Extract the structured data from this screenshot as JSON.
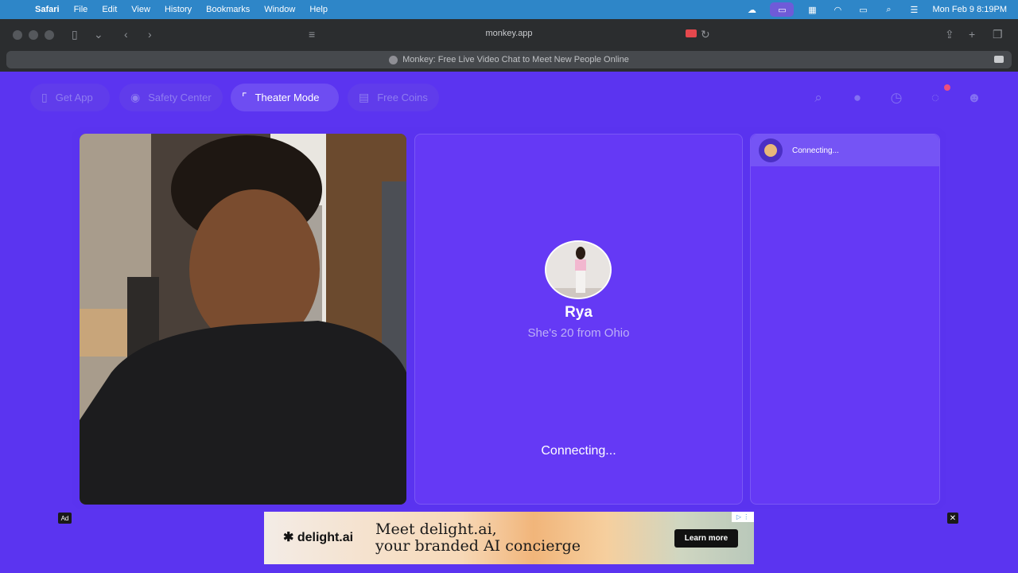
{
  "menubar": {
    "app_name": "Safari",
    "menus": [
      "File",
      "Edit",
      "View",
      "History",
      "Bookmarks",
      "Window",
      "Help"
    ],
    "datetime": "Mon Feb 9  8:19PM"
  },
  "browser": {
    "url": "monkey.app",
    "tab_title": "Monkey: Free Live Video Chat to Meet New People Online"
  },
  "header": {
    "nav": [
      {
        "label": "Get App",
        "icon": "phone-icon"
      },
      {
        "label": "Safety Center",
        "icon": "shield-icon"
      },
      {
        "label": "Theater Mode",
        "icon": "expand-icon"
      },
      {
        "label": "Free Coins",
        "icon": "coins-icon"
      }
    ],
    "icons": [
      "search-icon",
      "avatar-icon",
      "history-icon",
      "chat-icon",
      "monkey-icon"
    ]
  },
  "peer": {
    "name": "Rya",
    "subtitle": "She's 20 from Ohio",
    "status": "Connecting..."
  },
  "chat": {
    "status": "Connecting..."
  },
  "ad": {
    "tag": "Ad",
    "brand": "delight.ai",
    "headline_line1": "Meet delight.ai,",
    "headline_line2": "your branded AI concierge",
    "cta": "Learn more",
    "close": "✕"
  },
  "colors": {
    "background": "#5b34f0",
    "panel": "#6539f5",
    "menubar": "#2e86c8",
    "badge": "#ef4f7c"
  }
}
